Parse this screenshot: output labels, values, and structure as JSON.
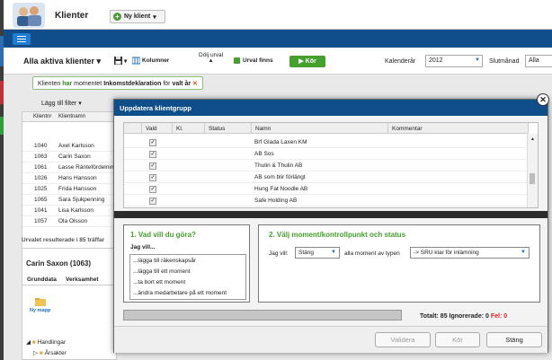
{
  "app": {
    "title": "Klienter",
    "new_client": "Ny klient"
  },
  "toolbar": {
    "all_active": "Alla aktiva klienter",
    "columns": "Kolumner",
    "hide_selection": "Dölj urval",
    "selection_exists": "Urval finns",
    "run": "Kör",
    "calendar_year_label": "Kalenderår",
    "calendar_year_value": "2012",
    "end_month_label": "Slutmånad",
    "end_month_value": "Alla"
  },
  "filter": {
    "prefix": "Klienten",
    "has": "har",
    "moment_word": "momentet",
    "moment": "Inkomstdeklaration",
    "for": "för",
    "period": "valt år",
    "add_filter": "Lägg till filter"
  },
  "client_grid": {
    "headers": [
      "Klientnr",
      "Klientnamn"
    ],
    "rows": [
      {
        "nr": "1040",
        "name": "Axel Karlsson"
      },
      {
        "nr": "1063",
        "name": "Carin Saxon"
      },
      {
        "nr": "1061",
        "name": "Lasse Räntefördelning"
      },
      {
        "nr": "1026",
        "name": "Hans Hansson"
      },
      {
        "nr": "1025",
        "name": "Frida Hansson"
      },
      {
        "nr": "1065",
        "name": "Sara Sjukpenning"
      },
      {
        "nr": "1041",
        "name": "Lisa Karlsson"
      },
      {
        "nr": "1057",
        "name": "Ola Olsson"
      }
    ],
    "footer": "Urvalet resulterade i 85 träffar"
  },
  "detail": {
    "title": "Carin Saxon (1063)",
    "tabs": [
      "Grunddata",
      "Verksamhet"
    ],
    "new_folder": "Ny mapp",
    "tree": [
      "Handlingar",
      "Årsakter"
    ]
  },
  "dialog": {
    "title": "Uppdatera klientgrupp",
    "columns": [
      "Vald",
      "Kl.",
      "Status",
      "Namn",
      "Kommentar"
    ],
    "rows": [
      {
        "name": "Brf Glada Laxen KM"
      },
      {
        "name": "AB Sos"
      },
      {
        "name": "Thulin & Thulin AB"
      },
      {
        "name": "AB som blir förlängt"
      },
      {
        "name": "Hung Fat Noodle AB"
      },
      {
        "name": "Safe Holding AB"
      }
    ],
    "step1_title": "1. Vad vill du göra?",
    "step1_sub": "Jag vill...",
    "actions": [
      "...lägga till räkenskapsår",
      "...lägga till ett moment",
      "...ta bort ett moment",
      "...ändra medarbetare på ett moment"
    ],
    "step2_title": "2. Välj moment/kontrollpunkt och status",
    "jag_vill": "Jag vill:",
    "action_value": "Stäng",
    "all_moments": "alla moment av typen",
    "moment_value": "-> SRU klar för inlämning",
    "total_label": "Totalt: 85 Ignorerade: 0",
    "error_label": "Fel: 0",
    "btn_validate": "Validera",
    "btn_run": "Kör",
    "btn_close": "Stäng"
  },
  "colors": {
    "accent": "#0f4e8a",
    "green": "#45a02d",
    "error": "#d21f1f"
  }
}
